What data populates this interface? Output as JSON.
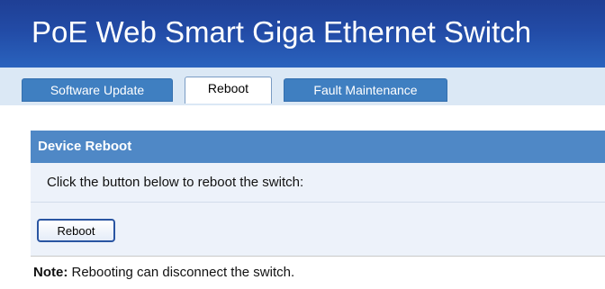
{
  "header": {
    "title": "PoE Web Smart Giga Ethernet Switch"
  },
  "tabs": [
    {
      "label": "Software Update",
      "active": false
    },
    {
      "label": "Reboot",
      "active": true
    },
    {
      "label": "Fault Maintenance",
      "active": false
    }
  ],
  "section": {
    "title": "Device Reboot",
    "description": "Click the button below to reboot the switch:",
    "button_label": "Reboot"
  },
  "note": {
    "label": "Note:",
    "text": "Rebooting can disconnect the switch."
  },
  "colors": {
    "header_bg": "#224ba6",
    "tab_inactive": "#3f7fc1",
    "section_header": "#4f88c6",
    "row_bg": "#edf2fa"
  }
}
